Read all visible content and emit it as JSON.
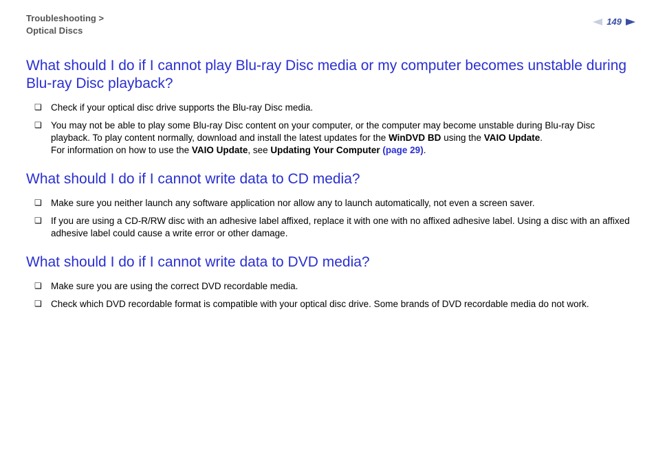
{
  "header": {
    "breadcrumb_top": "Troubleshooting >",
    "breadcrumb_sub": "Optical Discs",
    "page_number": "149"
  },
  "sections": [
    {
      "heading": "What should I do if I cannot play Blu-ray Disc media or my computer becomes unstable during Blu-ray Disc playback?",
      "items": [
        {
          "pre": "Check if your optical disc drive supports the Blu-ray Disc media."
        },
        {
          "pre": "You may not be able to play some Blu-ray Disc content on your computer, or the computer may become unstable during Blu-ray Disc playback. To play content normally, download and install the latest updates for the ",
          "b1": "WinDVD BD",
          "mid1": " using the ",
          "b2": "VAIO Update",
          "mid2": ".",
          "br": true,
          "post1": "For information on how to use the ",
          "b3": "VAIO Update",
          "post2": ", see ",
          "b4": "Updating Your Computer ",
          "link": "(page 29)",
          "tail": "."
        }
      ]
    },
    {
      "heading": "What should I do if I cannot write data to CD media?",
      "items": [
        {
          "pre": "Make sure you neither launch any software application nor allow any to launch automatically, not even a screen saver."
        },
        {
          "pre": "If you are using a CD-R/RW disc with an adhesive label affixed, replace it with one with no affixed adhesive label. Using a disc with an affixed adhesive label could cause a write error or other damage."
        }
      ]
    },
    {
      "heading": "What should I do if I cannot write data to DVD media?",
      "items": [
        {
          "pre": "Make sure you are using the correct DVD recordable media."
        },
        {
          "pre": "Check which DVD recordable format is compatible with your optical disc drive. Some brands of DVD recordable media do not work."
        }
      ]
    }
  ]
}
